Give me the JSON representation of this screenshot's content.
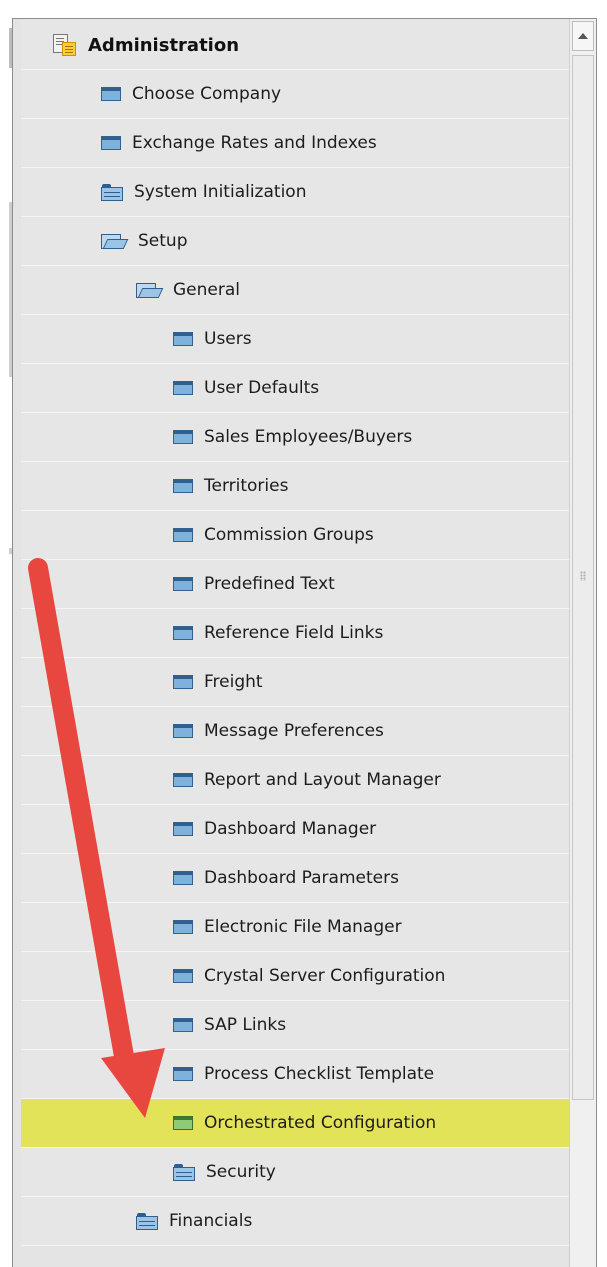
{
  "tree": {
    "items": [
      {
        "label": "Administration",
        "icon": "module-icon",
        "level": 0
      },
      {
        "label": "Choose Company",
        "icon": "window-icon",
        "level": 1
      },
      {
        "label": "Exchange Rates and Indexes",
        "icon": "window-icon",
        "level": 1
      },
      {
        "label": "System Initialization",
        "icon": "folder-icon",
        "level": 1
      },
      {
        "label": "Setup",
        "icon": "folder-open-icon",
        "level": 1
      },
      {
        "label": "General",
        "icon": "folder-open-icon",
        "level": 2
      },
      {
        "label": "Users",
        "icon": "window-icon",
        "level": 3
      },
      {
        "label": "User Defaults",
        "icon": "window-icon",
        "level": 3
      },
      {
        "label": "Sales Employees/Buyers",
        "icon": "window-icon",
        "level": 3
      },
      {
        "label": "Territories",
        "icon": "window-icon",
        "level": 3
      },
      {
        "label": "Commission Groups",
        "icon": "window-icon",
        "level": 3
      },
      {
        "label": "Predefined Text",
        "icon": "window-icon",
        "level": 3
      },
      {
        "label": "Reference Field Links",
        "icon": "window-icon",
        "level": 3
      },
      {
        "label": "Freight",
        "icon": "window-icon",
        "level": 3
      },
      {
        "label": "Message Preferences",
        "icon": "window-icon",
        "level": 3
      },
      {
        "label": "Report and Layout Manager",
        "icon": "window-icon",
        "level": 3
      },
      {
        "label": "Dashboard Manager",
        "icon": "window-icon",
        "level": 3
      },
      {
        "label": "Dashboard Parameters",
        "icon": "window-icon",
        "level": 3
      },
      {
        "label": "Electronic File Manager",
        "icon": "window-icon",
        "level": 3
      },
      {
        "label": "Crystal Server Configuration",
        "icon": "window-icon",
        "level": 3
      },
      {
        "label": "SAP Links",
        "icon": "window-icon",
        "level": 3
      },
      {
        "label": "Process Checklist Template",
        "icon": "window-icon",
        "level": 3
      },
      {
        "label": "Orchestrated Configuration",
        "icon": "window-icon-green",
        "level": 3,
        "highlighted": true
      },
      {
        "label": "Security",
        "icon": "folder-icon",
        "level": 3
      },
      {
        "label": "Financials",
        "icon": "folder-icon",
        "level": 2
      }
    ]
  },
  "colors": {
    "highlight": "#e3e35a",
    "annotation_arrow": "#e8473f"
  }
}
